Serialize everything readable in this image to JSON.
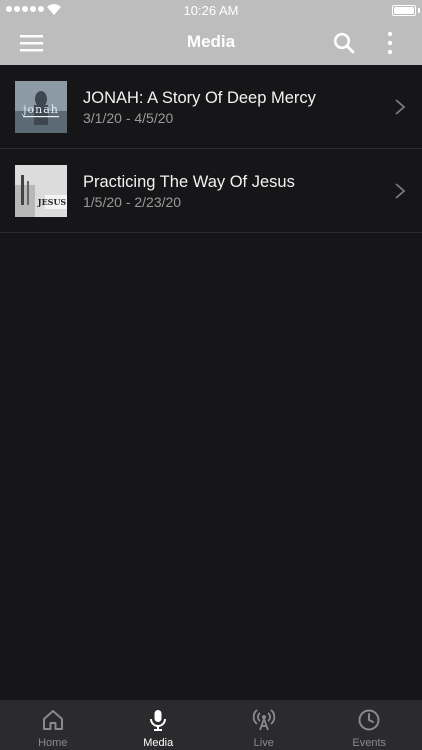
{
  "status_bar": {
    "time": "10:26 AM"
  },
  "header": {
    "title": "Media"
  },
  "icons": {
    "menu": "hamburger-menu-icon",
    "search": "search-icon",
    "more": "more-vertical-icon"
  },
  "media": [
    {
      "title": "JONAH: A Story Of Deep Mercy",
      "dates": "3/1/20 - 4/5/20",
      "thumb_text": "jonah"
    },
    {
      "title": "Practicing The Way Of Jesus",
      "dates": "1/5/20 - 2/23/20",
      "thumb_text": "JESUS"
    }
  ],
  "tabs": [
    {
      "label": "Home",
      "icon": "home-icon",
      "active": false
    },
    {
      "label": "Media",
      "icon": "microphone-icon",
      "active": true
    },
    {
      "label": "Live",
      "icon": "broadcast-icon",
      "active": false
    },
    {
      "label": "Events",
      "icon": "clock-icon",
      "active": false
    }
  ],
  "colors": {
    "header_bg": "#bdbdbd",
    "body_bg": "#161618",
    "tab_bar_bg": "#2b2b2d",
    "active_tab": "#ffffff",
    "inactive_tab": "#8a8a8e"
  }
}
